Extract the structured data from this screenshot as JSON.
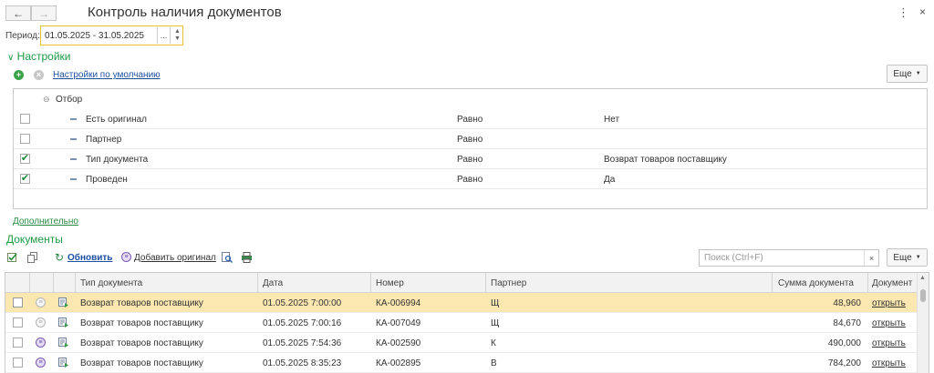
{
  "window": {
    "title": "Контроль наличия документов",
    "more_menu_icon": "vertical-ellipsis-icon",
    "close_icon": "close-icon"
  },
  "period": {
    "label": "Период:",
    "value": "01.05.2025 - 31.05.2025",
    "select_button": "...",
    "spin_up": "▲",
    "spin_down": "▼"
  },
  "settings": {
    "header": "Настройки",
    "default_settings_link": "Настройки по умолчанию",
    "more_button": "Еще",
    "group_label": "Отбор",
    "rows": [
      {
        "checked": false,
        "field": "Есть оригинал",
        "condition": "Равно",
        "value": "Нет"
      },
      {
        "checked": false,
        "field": "Партнер",
        "condition": "Равно",
        "value": ""
      },
      {
        "checked": true,
        "field": "Тип документа",
        "condition": "Равно",
        "value": "Возврат товаров поставщику"
      },
      {
        "checked": true,
        "field": "Проведен",
        "condition": "Равно",
        "value": "Да"
      }
    ],
    "additional_link": "Дополнительно"
  },
  "documents": {
    "header": "Документы",
    "refresh_button": "Обновить",
    "add_original_button": "Добавить оригинал",
    "search_placeholder": "Поиск (Ctrl+F)",
    "search_clear": "×",
    "more_button": "Еще",
    "columns": {
      "doc_type": "Тип документа",
      "date": "Дата",
      "number": "Номер",
      "partner": "Партнер",
      "sum": "Сумма документа",
      "document": "Документ"
    },
    "rows": [
      {
        "original": false,
        "doc_type": "Возврат товаров поставщику",
        "date": "01.05.2025 7:00:00",
        "number": "КА-006994",
        "partner": "Щ",
        "sum": "48,960",
        "link": "открыть",
        "selected": true
      },
      {
        "original": false,
        "doc_type": "Возврат товаров поставщику",
        "date": "01.05.2025 7:00:16",
        "number": "КА-007049",
        "partner": "Щ",
        "sum": "84,670",
        "link": "открыть",
        "selected": false
      },
      {
        "original": true,
        "doc_type": "Возврат товаров поставщику",
        "date": "01.05.2025 7:54:36",
        "number": "КА-002590",
        "partner": "К",
        "sum": "490,000",
        "link": "открыть",
        "selected": false
      },
      {
        "original": true,
        "doc_type": "Возврат товаров поставщику",
        "date": "01.05.2025 8:35:23",
        "number": "КА-002895",
        "partner": "В",
        "sum": "784,200",
        "link": "открыть",
        "selected": false
      }
    ]
  },
  "colors": {
    "accent_green": "#1f9a45",
    "focus_yellow": "#e6c22b",
    "selected_row": "#fbe8b0",
    "link_blue": "#1d4fa0"
  }
}
